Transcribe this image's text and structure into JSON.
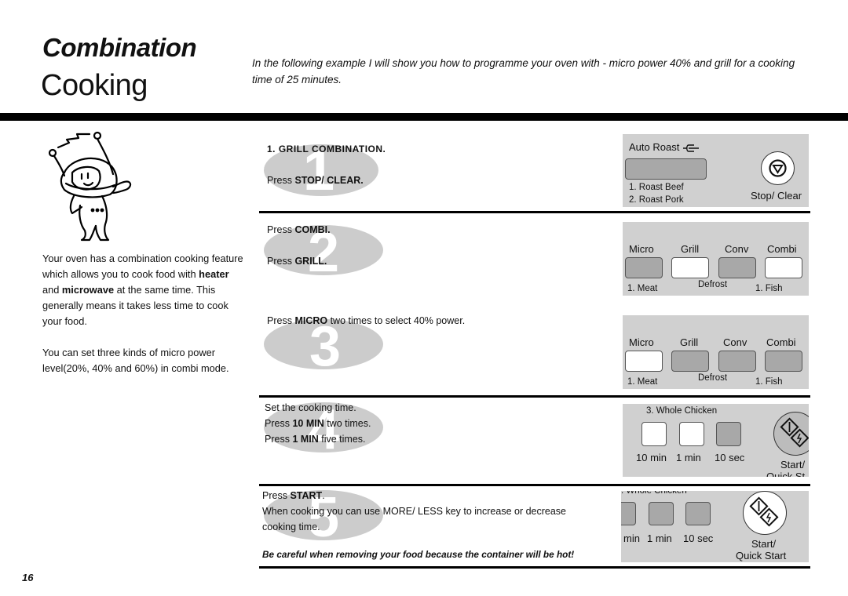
{
  "header": {
    "title_line1": "Combination",
    "title_line2": "Cooking",
    "intro": "In the following example I will show you how to programme your oven with - micro power 40% and grill for a cooking time of 25 minutes."
  },
  "sidebar": {
    "paragraph1_part1": "Your oven has a combination cooking feature which allows you to cook food with ",
    "paragraph1_bold1": "heater",
    "paragraph1_part2": " and ",
    "paragraph1_bold2": "microwave",
    "paragraph1_part3": " at the same time. This generally means it takes less time to cook your food.",
    "paragraph2": "You can set three kinds of micro power level(20%, 40% and 60%) in combi mode."
  },
  "steps": [
    {
      "number": "1",
      "heading": "1. GRILL COMBINATION.",
      "lines": [
        {
          "pre": "Press ",
          "bold": "STOP/ CLEAR.",
          "post": ""
        }
      ]
    },
    {
      "number": "2",
      "lines": [
        {
          "pre": "Press ",
          "bold": "COMBI.",
          "post": ""
        },
        {
          "pre": "Press ",
          "bold": "GRILL.",
          "post": ""
        }
      ]
    },
    {
      "number": "3",
      "lines": [
        {
          "pre": "Press ",
          "bold": "MICRO",
          "post": " two times to select 40% power."
        }
      ]
    },
    {
      "number": "4",
      "lines": [
        {
          "pre": "Set the cooking time.",
          "bold": "",
          "post": ""
        },
        {
          "pre": "Press ",
          "bold": "10 MIN",
          "post": " two times."
        },
        {
          "pre": "Press ",
          "bold": "1 MIN",
          "post": " five times."
        }
      ]
    },
    {
      "number": "5",
      "lines": [
        {
          "pre": "Press ",
          "bold": "START",
          "post": "."
        },
        {
          "pre": "When cooking you can use MORE/ LESS key to increase or decrease",
          "bold": "",
          "post": ""
        },
        {
          "pre": "cooking time.",
          "bold": "",
          "post": ""
        }
      ]
    }
  ],
  "warning": "Be careful when removing your food because the container will be hot!",
  "panels": {
    "auto_roast": {
      "label": "Auto Roast",
      "items": [
        "1. Roast Beef",
        "2. Roast Pork"
      ],
      "stop_label": "Stop/ Clear"
    },
    "mode_keys": {
      "labels": [
        "Micro",
        "Grill",
        "Conv",
        "Combi"
      ],
      "sub_left": "1. Meat",
      "sub_mid": "Defrost",
      "sub_right": "1. Fish",
      "step2_pressed": [
        false,
        true,
        false,
        true
      ],
      "step3_pressed": [
        true,
        false,
        false,
        false
      ]
    },
    "time_keys": {
      "heading": "3. Whole Chicken",
      "heading_cut": ". Whole Chicken",
      "labels": [
        "10 min",
        "1 min",
        "10 sec"
      ],
      "labels_cut": [
        "min",
        "1 min",
        "10 sec"
      ],
      "step4_pressed": [
        true,
        true,
        false
      ],
      "start_label_1": "Start/",
      "start_label_2": "Quick Start",
      "start_label_2_cut": "Quick St"
    }
  },
  "page_number": "16",
  "colors": {
    "panel_bg": "#d0d0d0",
    "key_off": "#a8a8a8",
    "key_on": "#ffffff",
    "badge": "#cccccc"
  }
}
